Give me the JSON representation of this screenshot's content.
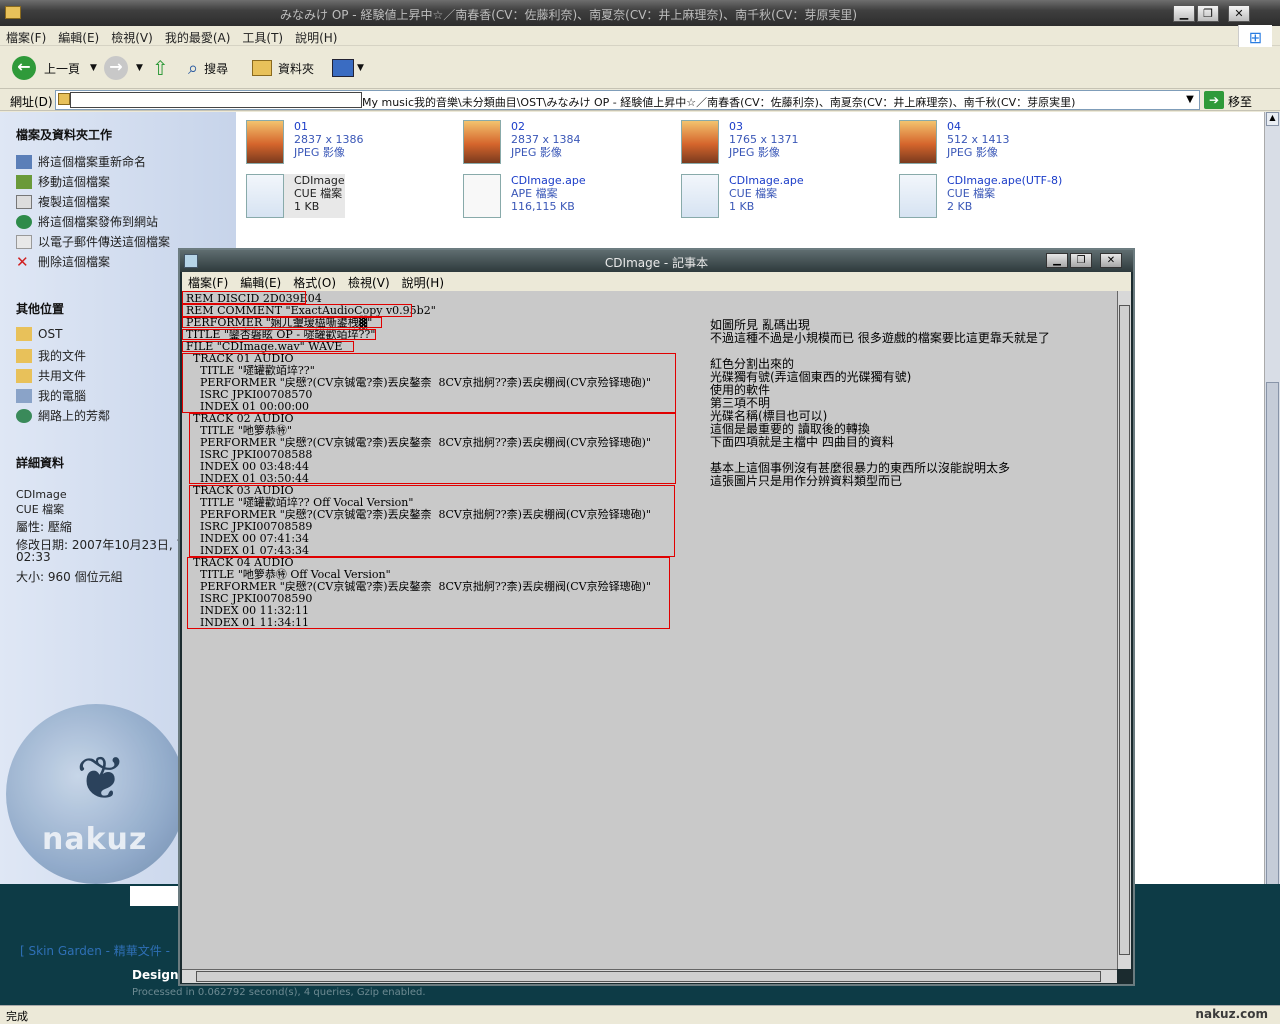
{
  "explorer": {
    "title": "みなみけ OP - 経験値上昇中☆／南春香(CV：佐藤利奈)、南夏奈(CV：井上麻理奈)、南千秋(CV：芽原実里)",
    "menu": [
      "檔案(F)",
      "編輯(E)",
      "檢視(V)",
      "我的最愛(A)",
      "工具(T)",
      "說明(H)"
    ],
    "toolbar": {
      "back": "上一頁",
      "search": "搜尋",
      "folders": "資料夾"
    },
    "address": {
      "label": "網址(D)",
      "path": "My music我的音樂\\未分類曲目\\OST\\みなみけ OP - 経験値上昇中☆／南春香(CV：佐藤利奈)、南夏奈(CV：井上麻理奈)、南千秋(CV：芽原実里)",
      "go": "移至"
    },
    "tasks": {
      "heading": "檔案及資料夾工作",
      "items": [
        "將這個檔案重新命名",
        "移動這個檔案",
        "複製這個檔案",
        "將這個檔案發佈到網站",
        "以電子郵件傳送這個檔案",
        "刪除這個檔案"
      ]
    },
    "places": {
      "heading": "其他位置",
      "items": [
        "OST",
        "我的文件",
        "共用文件",
        "我的電腦",
        "網路上的芳鄰"
      ]
    },
    "details": {
      "heading": "詳細資料",
      "name": "CDImage",
      "type": "CUE 檔案",
      "attr": "屬性: 壓縮",
      "modified": "修改日期: 2007年10月23日, 下午",
      "modified2": "02:33",
      "size": "大小: 960 個位元組"
    },
    "logo_text": "nakuz",
    "files": [
      {
        "name": "01",
        "l2": "2837 x 1386",
        "l3": "JPEG 影像"
      },
      {
        "name": "02",
        "l2": "2837 x 1384",
        "l3": "JPEG 影像"
      },
      {
        "name": "03",
        "l2": "1765 x 1371",
        "l3": "JPEG 影像"
      },
      {
        "name": "04",
        "l2": "512 x 1413",
        "l3": "JPEG 影像"
      },
      {
        "name": "CDImage",
        "l2": "CUE 檔案",
        "l3": "1 KB"
      },
      {
        "name": "CDImage.ape",
        "l2": "APE 檔案",
        "l3": "116,115 KB"
      },
      {
        "name": "CDImage.ape",
        "l2": "CUE 檔案",
        "l3": "1 KB"
      },
      {
        "name": "CDImage.ape(UTF-8)",
        "l2": "CUE 檔案",
        "l3": "2 KB"
      }
    ],
    "status": "完成",
    "watermark": "nakuz.com"
  },
  "background_page": {
    "links": "[ Skin Garden - 精華文件 - ",
    "designed": "Designe",
    "processed": "Processed in 0.062792 second(s), 4 queries, Gzip enabled."
  },
  "notepad": {
    "title": "CDImage - 記事本",
    "menu": [
      "檔案(F)",
      "編輯(E)",
      "格式(O)",
      "檢視(V)",
      "說明(H)"
    ],
    "content": "REM DISCID 2D039E04\nREM COMMENT \"ExactAudioCopy v0.95b2\"\nPERFORMER \"娴ㄦ瓕瑷橀噺鍙栧▓\"\nTITLE \"鑾杏磐眩 OP - 嚃罐歡竡埣??\"\nFILE \"CDImage.wav\" WAVE\n  TRACK 01 AUDIO\n    TITLE \"嚃罐歡竡埣??\"\n    PERFORMER \"戻憵?(CV京铖電?柰)丟戻鏊柰  8CV京拙舸??柰)丟戻棚阀(CV京殓铎璁砲)\"\n    ISRC JPKI00708570\n    INDEX 01 00:00:00\n  TRACK 02 AUDIO\n    TITLE \"吔箩恭㊕\"\n    PERFORMER \"戻憵?(CV京铖電?柰)丟戻鏊柰  8CV京拙舸??柰)丟戻棚阀(CV京殓铎璁砲)\"\n    ISRC JPKI00708588\n    INDEX 00 03:48:44\n    INDEX 01 03:50:44\n  TRACK 03 AUDIO\n    TITLE \"嚃罐歡竡埣?? Off Vocal Version\"\n    PERFORMER \"戻憵?(CV京铖電?柰)丟戻鏊柰  8CV京拙舸??柰)丟戻棚阀(CV京殓铎璁砲)\"\n    ISRC JPKI00708589\n    INDEX 00 07:41:34\n    INDEX 01 07:43:34\n  TRACK 04 AUDIO\n    TITLE \"吔箩恭㊕ Off Vocal Version\"\n    PERFORMER \"戻憵?(CV京铖電?柰)丟戻鏊柰  8CV京拙舸??柰)丟戻棚阀(CV京殓铎璁砲)\"\n    ISRC JPKI00708590\n    INDEX 00 11:32:11\n    INDEX 01 11:34:11",
    "comment": "如圖所見 亂碼出現\n不過這種不過是小規模而已 很多遊戲的檔案要比這更靠夭就是了\n\n紅色分割出來的\n光碟獨有號(弄這個東西的光碟獨有號)\n使用的軟件\n第三項不明\n光碟名稱(標目也可以)\n這個是最重要的 讀取後的轉換\n下面四項就是主檔中 四曲目的資料\n\n基本上這個事例沒有甚麼很暴力的東西所以沒能說明太多\n這張圖片只是用作分辨資料類型而已"
  },
  "colors": {
    "highlight": "#e00000",
    "link": "#1a3cc8",
    "background": "#0d3b46"
  }
}
